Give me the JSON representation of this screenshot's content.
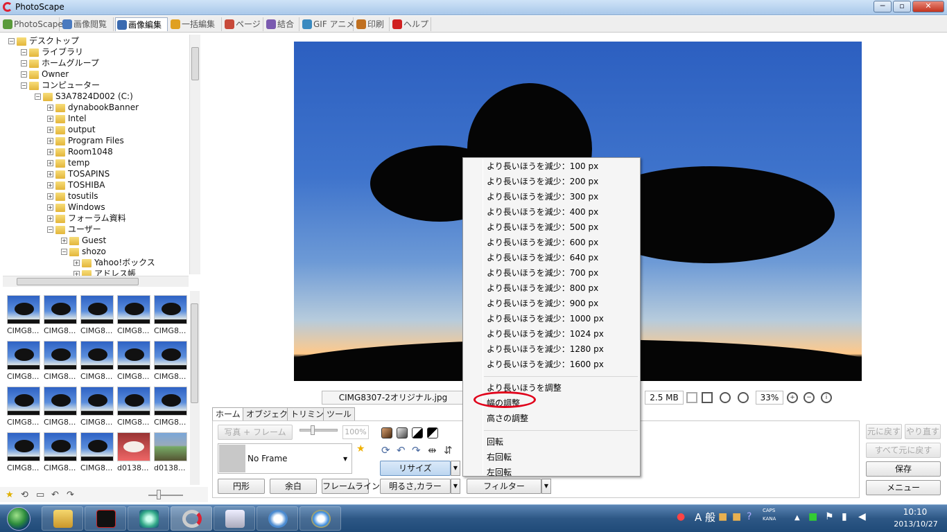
{
  "window": {
    "title": "PhotoScape",
    "min_label": "─",
    "max_label": "▫",
    "close_label": "✕"
  },
  "tabs": [
    {
      "label": "PhotoScape",
      "color": "#5a9a3a"
    },
    {
      "label": "画像閲覧",
      "color": "#4a7abf"
    },
    {
      "label": "画像編集",
      "color": "#3a6ab0"
    },
    {
      "label": "一括編集",
      "color": "#e0a020"
    },
    {
      "label": "ページ",
      "color": "#c84a3a"
    },
    {
      "label": "結合",
      "color": "#7a5ab0"
    },
    {
      "label": "GIF アニメ",
      "color": "#3a8ac0"
    },
    {
      "label": "印刷",
      "color": "#c07020"
    },
    {
      "label": "ヘルプ",
      "color": "#d02020"
    }
  ],
  "tree": {
    "nodes": [
      {
        "label": "デスクトップ",
        "depth": 0
      },
      {
        "label": "ライブラリ",
        "depth": 1
      },
      {
        "label": "ホームグループ",
        "depth": 1
      },
      {
        "label": "Owner",
        "depth": 1
      },
      {
        "label": "コンピューター",
        "depth": 1
      },
      {
        "label": "S3A7824D002 (C:)",
        "depth": 2
      },
      {
        "label": "dynabookBanner",
        "depth": 3
      },
      {
        "label": "Intel",
        "depth": 3
      },
      {
        "label": "output",
        "depth": 3
      },
      {
        "label": "Program Files",
        "depth": 3
      },
      {
        "label": "Room1048",
        "depth": 3
      },
      {
        "label": "temp",
        "depth": 3
      },
      {
        "label": "TOSAPINS",
        "depth": 3
      },
      {
        "label": "TOSHIBA",
        "depth": 3
      },
      {
        "label": "tosutils",
        "depth": 3
      },
      {
        "label": "Windows",
        "depth": 3
      },
      {
        "label": "フォーラム資料",
        "depth": 3
      },
      {
        "label": "ユーザー",
        "depth": 3
      },
      {
        "label": "Guest",
        "depth": 4
      },
      {
        "label": "shozo",
        "depth": 4
      },
      {
        "label": "Yahoo!ボックス",
        "depth": 5
      },
      {
        "label": "アドレス帳",
        "depth": 5
      }
    ]
  },
  "thumbnails": [
    "CIMG8...",
    "CIMG8...",
    "CIMG8...",
    "CIMG8...",
    "CIMG8...",
    "CIMG8...",
    "CIMG8...",
    "CIMG8...",
    "CIMG8...",
    "CIMG8...",
    "CIMG8...",
    "CIMG8...",
    "CIMG8...",
    "CIMG8...",
    "CIMG8...",
    "CIMG8...",
    "CIMG8...",
    "CIMG8...",
    "d0138...",
    "d0138..."
  ],
  "status": {
    "filename": "CIMG8307-2オリジナル.jpg",
    "filesize": "2.5 MB",
    "zoom": "33%"
  },
  "editor": {
    "tabs": [
      "ホーム",
      "オブジェクト",
      "トリミング",
      "ツール"
    ],
    "photo_frame_btn": "写真 + フレーム",
    "percent": "100%",
    "frame_value": "No Frame",
    "round_btn": "円形",
    "margin_btn": "余白",
    "frameline_btn": "フレームライン",
    "resize_btn": "リサイズ",
    "brightness_btn": "明るさ,カラー",
    "filter_btn": "フィルター",
    "undo_btn": "元に戻す",
    "redo_btn": "やり直す",
    "undo_all_btn": "すべて元に戻す",
    "save_btn": "保存",
    "menu_btn": "メニュー"
  },
  "context_menu": {
    "reduce_items": [
      "より長いほうを減少：100 px",
      "より長いほうを減少：200 px",
      "より長いほうを減少：300 px",
      "より長いほうを減少：400 px",
      "より長いほうを減少：500 px",
      "より長いほうを減少：600 px",
      "より長いほうを減少：640 px",
      "より長いほうを減少：700 px",
      "より長いほうを減少：800 px",
      "より長いほうを減少：900 px",
      "より長いほうを減少：1000 px",
      "より長いほうを減少：1024 px",
      "より長いほうを減少：1280 px",
      "より長いほうを減少：1600 px"
    ],
    "adjust_items": [
      "より長いほうを調整",
      "幅の調整",
      "高さの調整"
    ],
    "rotate_items": [
      "回転",
      "右回転",
      "左回転"
    ],
    "highlight_color": "#e0001a"
  },
  "taskbar": {
    "ime_label": "A 般",
    "caps_label": "CAPS",
    "kana_label": "KANA",
    "time": "10:10",
    "date": "2013/10/27"
  }
}
